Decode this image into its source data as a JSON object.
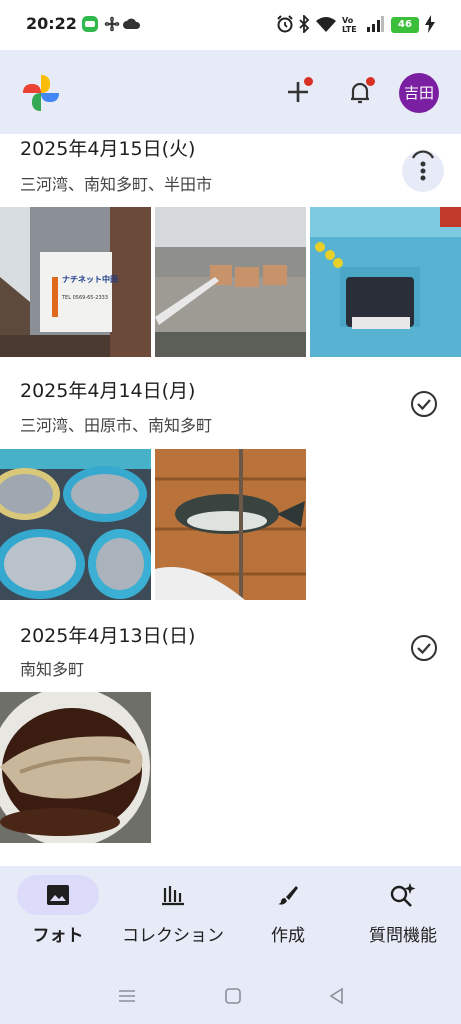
{
  "status_bar": {
    "time": "20:22",
    "battery": "46"
  },
  "header": {
    "avatar_text": "吉田"
  },
  "sections": [
    {
      "date": "2025年4月15日(火)",
      "location": "三河湾、南知多町、半田市"
    },
    {
      "date": "2025年4月14日(月)",
      "location": "三河湾、田原市、南知多町"
    },
    {
      "date": "2025年4月13日(日)",
      "location": "南知多町"
    }
  ],
  "photo_signage": {
    "line1": "ナチネット中田",
    "line2": "TEL 0569-65-2333"
  },
  "bottom_nav": [
    {
      "label": "フォト",
      "icon": "photo-icon",
      "active": true
    },
    {
      "label": "コレクション",
      "icon": "collection-icon",
      "active": false
    },
    {
      "label": "作成",
      "icon": "brush-icon",
      "active": false
    },
    {
      "label": "質問機能",
      "icon": "ask-icon",
      "active": false
    }
  ],
  "colors": {
    "appbar_bg": "#e7ebf7",
    "avatar": "#7b1fa2",
    "active_pill": "#dcdcfa",
    "notif_dot": "#d93025"
  }
}
